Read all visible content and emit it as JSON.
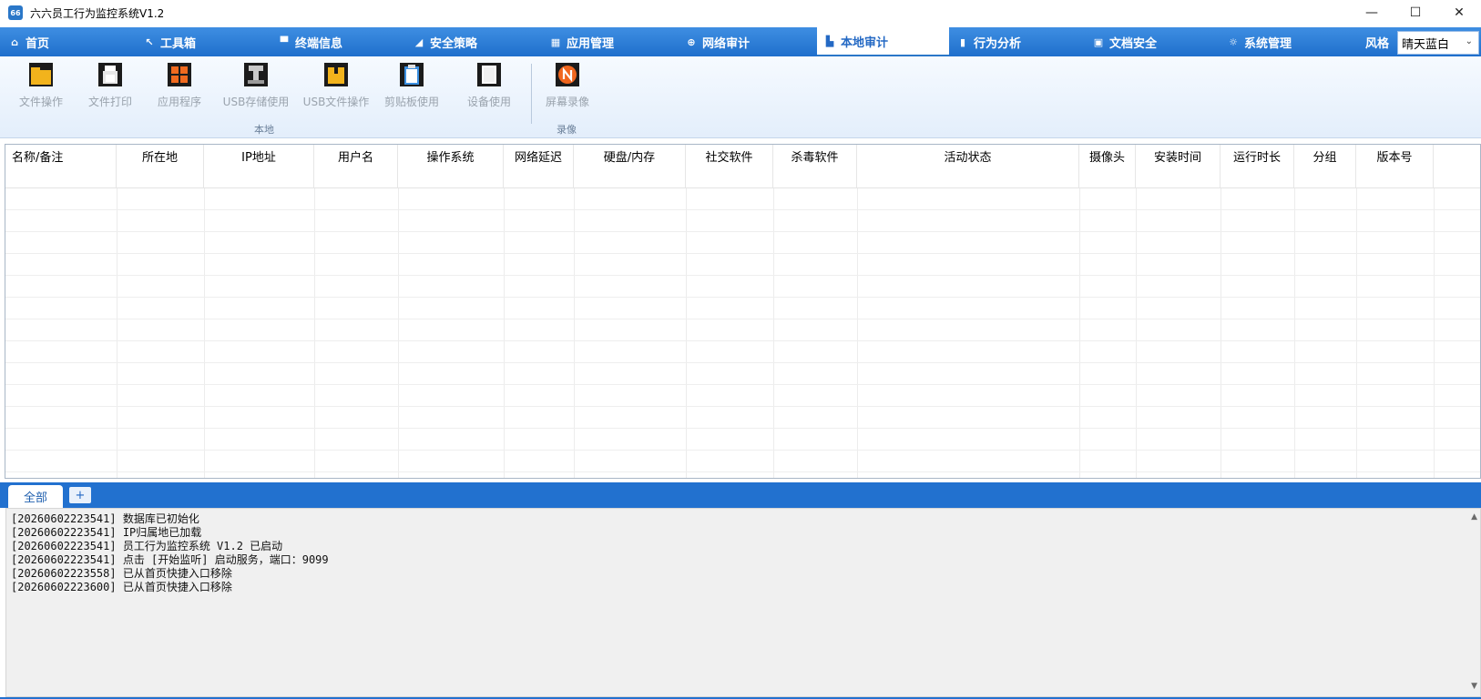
{
  "window": {
    "logo_text": "66",
    "title": "六六员工行为监控系统V1.2",
    "minimize": "—",
    "maximize": "☐",
    "close": "✕"
  },
  "menu": {
    "items": [
      {
        "label": "首页",
        "icon": "home-icon",
        "glyph": "⌂"
      },
      {
        "label": "工具箱",
        "icon": "wrench-icon",
        "glyph": "↖"
      },
      {
        "label": "终端信息",
        "icon": "monitor-icon",
        "glyph": "▀"
      },
      {
        "label": "安全策略",
        "icon": "shield-icon",
        "glyph": "◢"
      },
      {
        "label": "应用管理",
        "icon": "grid-icon",
        "glyph": "▦"
      },
      {
        "label": "网络审计",
        "icon": "globe-icon",
        "glyph": "⊕"
      },
      {
        "label": "本地审计",
        "icon": "folder-icon",
        "glyph": "▙"
      },
      {
        "label": "行为分析",
        "icon": "chart-icon",
        "glyph": "▮"
      },
      {
        "label": "文档安全",
        "icon": "document-icon",
        "glyph": "▣"
      },
      {
        "label": "系统管理",
        "icon": "gear-icon",
        "glyph": "☼"
      }
    ],
    "active_index": 6,
    "style_label": "风格",
    "style_value": "晴天蓝白"
  },
  "ribbon": {
    "tools": [
      {
        "label": "文件操作",
        "icon": "folder-icon"
      },
      {
        "label": "文件打印",
        "icon": "printer-icon"
      },
      {
        "label": "应用程序",
        "icon": "apps-icon"
      },
      {
        "label": "USB存储使用",
        "icon": "usb-icon"
      },
      {
        "label": "USB文件操作",
        "icon": "usb-file-icon"
      },
      {
        "label": "剪贴板使用",
        "icon": "clipboard-icon"
      },
      {
        "label": "设备使用",
        "icon": "device-icon"
      },
      {
        "label": "屏幕录像",
        "icon": "screen-record-icon"
      }
    ],
    "groups": {
      "local": "本地",
      "record": "录像"
    }
  },
  "table": {
    "columns": [
      "名称/备注",
      "所在地",
      "IP地址",
      "用户名",
      "操作系统",
      "网络延迟",
      "硬盘/内存",
      "社交软件",
      "杀毒软件",
      "活动状态",
      "摄像头",
      "安装时间",
      "运行时长",
      "分组",
      "版本号"
    ]
  },
  "tabs": {
    "all_label": "全部",
    "add_label": "+"
  },
  "log": {
    "lines": [
      "[20260602223541] 数据库已初始化",
      "[20260602223541] IP归属地已加载",
      "[20260602223541] 员工行为监控系统 V1.2 已启动",
      "[20260602223541] 点击 [开始监听] 启动服务，端口：9099",
      "[20260602223558] 已从首页快捷入口移除",
      "[20260602223600] 已从首页快捷入口移除"
    ],
    "scroll_up": "▲",
    "scroll_down": "▼"
  }
}
